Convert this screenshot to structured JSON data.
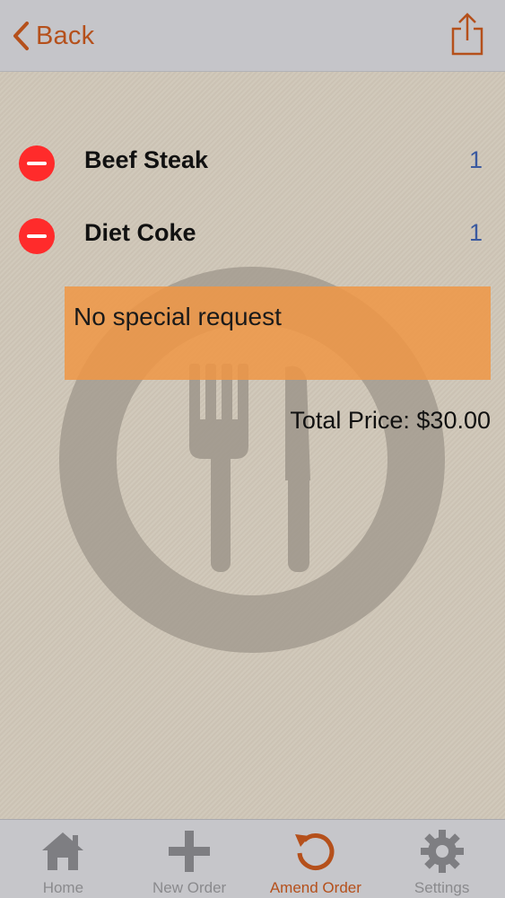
{
  "nav": {
    "back_label": "Back"
  },
  "order": {
    "items": [
      {
        "name": "Beef Steak",
        "qty": "1"
      },
      {
        "name": "Diet Coke",
        "qty": "1"
      }
    ],
    "special_request": "No special request",
    "total_text": "Total Price: $30.00"
  },
  "tabs": [
    {
      "label": "Home",
      "icon": "home-icon"
    },
    {
      "label": "New Order",
      "icon": "plus-icon"
    },
    {
      "label": "Amend Order",
      "icon": "refresh-icon",
      "active": true
    },
    {
      "label": "Settings",
      "icon": "gear-icon"
    }
  ],
  "colors": {
    "accent": "#b5501b",
    "delete": "#ff2b2b",
    "request_box": "#f09744",
    "quantity": "#3b5aa0",
    "background": "#cfc6b7"
  }
}
